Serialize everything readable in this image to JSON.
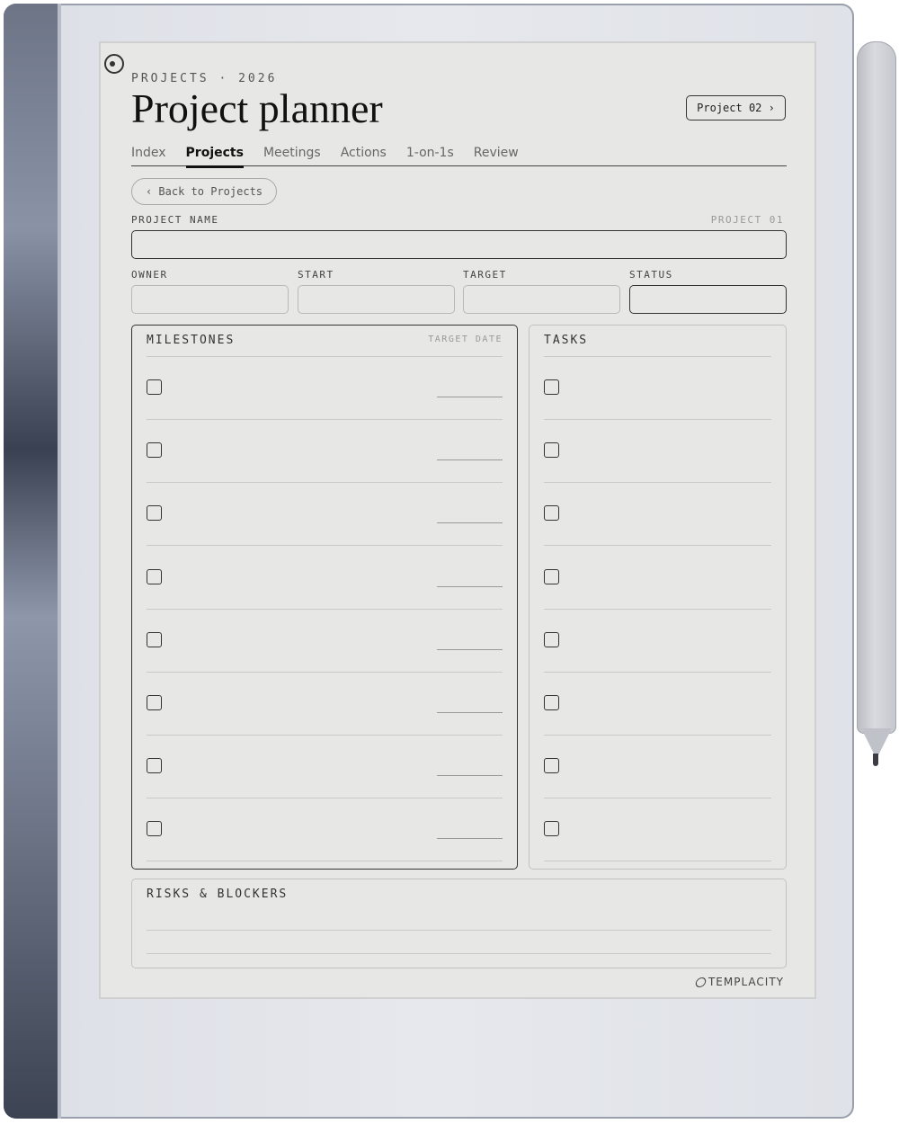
{
  "header": {
    "eyebrow": "PROJECTS · 2026",
    "title": "Project planner",
    "project_button": "Project 02 ›"
  },
  "tabs": [
    {
      "label": "Index",
      "active": false
    },
    {
      "label": "Projects",
      "active": true
    },
    {
      "label": "Meetings",
      "active": false
    },
    {
      "label": "Actions",
      "active": false
    },
    {
      "label": "1-on-1s",
      "active": false
    },
    {
      "label": "Review",
      "active": false
    }
  ],
  "back_button": "‹ Back to Projects",
  "project_name": {
    "label": "PROJECT NAME",
    "number": "PROJECT 01",
    "value": ""
  },
  "meta_fields": {
    "owner": {
      "label": "OWNER",
      "value": ""
    },
    "start": {
      "label": "START",
      "value": ""
    },
    "target": {
      "label": "TARGET",
      "value": ""
    },
    "status": {
      "label": "STATUS",
      "value": ""
    }
  },
  "milestones": {
    "title": "MILESTONES",
    "column_label": "TARGET DATE",
    "row_count": 8
  },
  "tasks": {
    "title": "TASKS",
    "row_count": 8
  },
  "risks": {
    "title": "RISKS & BLOCKERS"
  },
  "brand": "TEMPLACITY",
  "icons": {
    "camera": "camera-icon",
    "checkbox": "checkbox-icon",
    "brand_logo": "templacity-logo-icon"
  }
}
